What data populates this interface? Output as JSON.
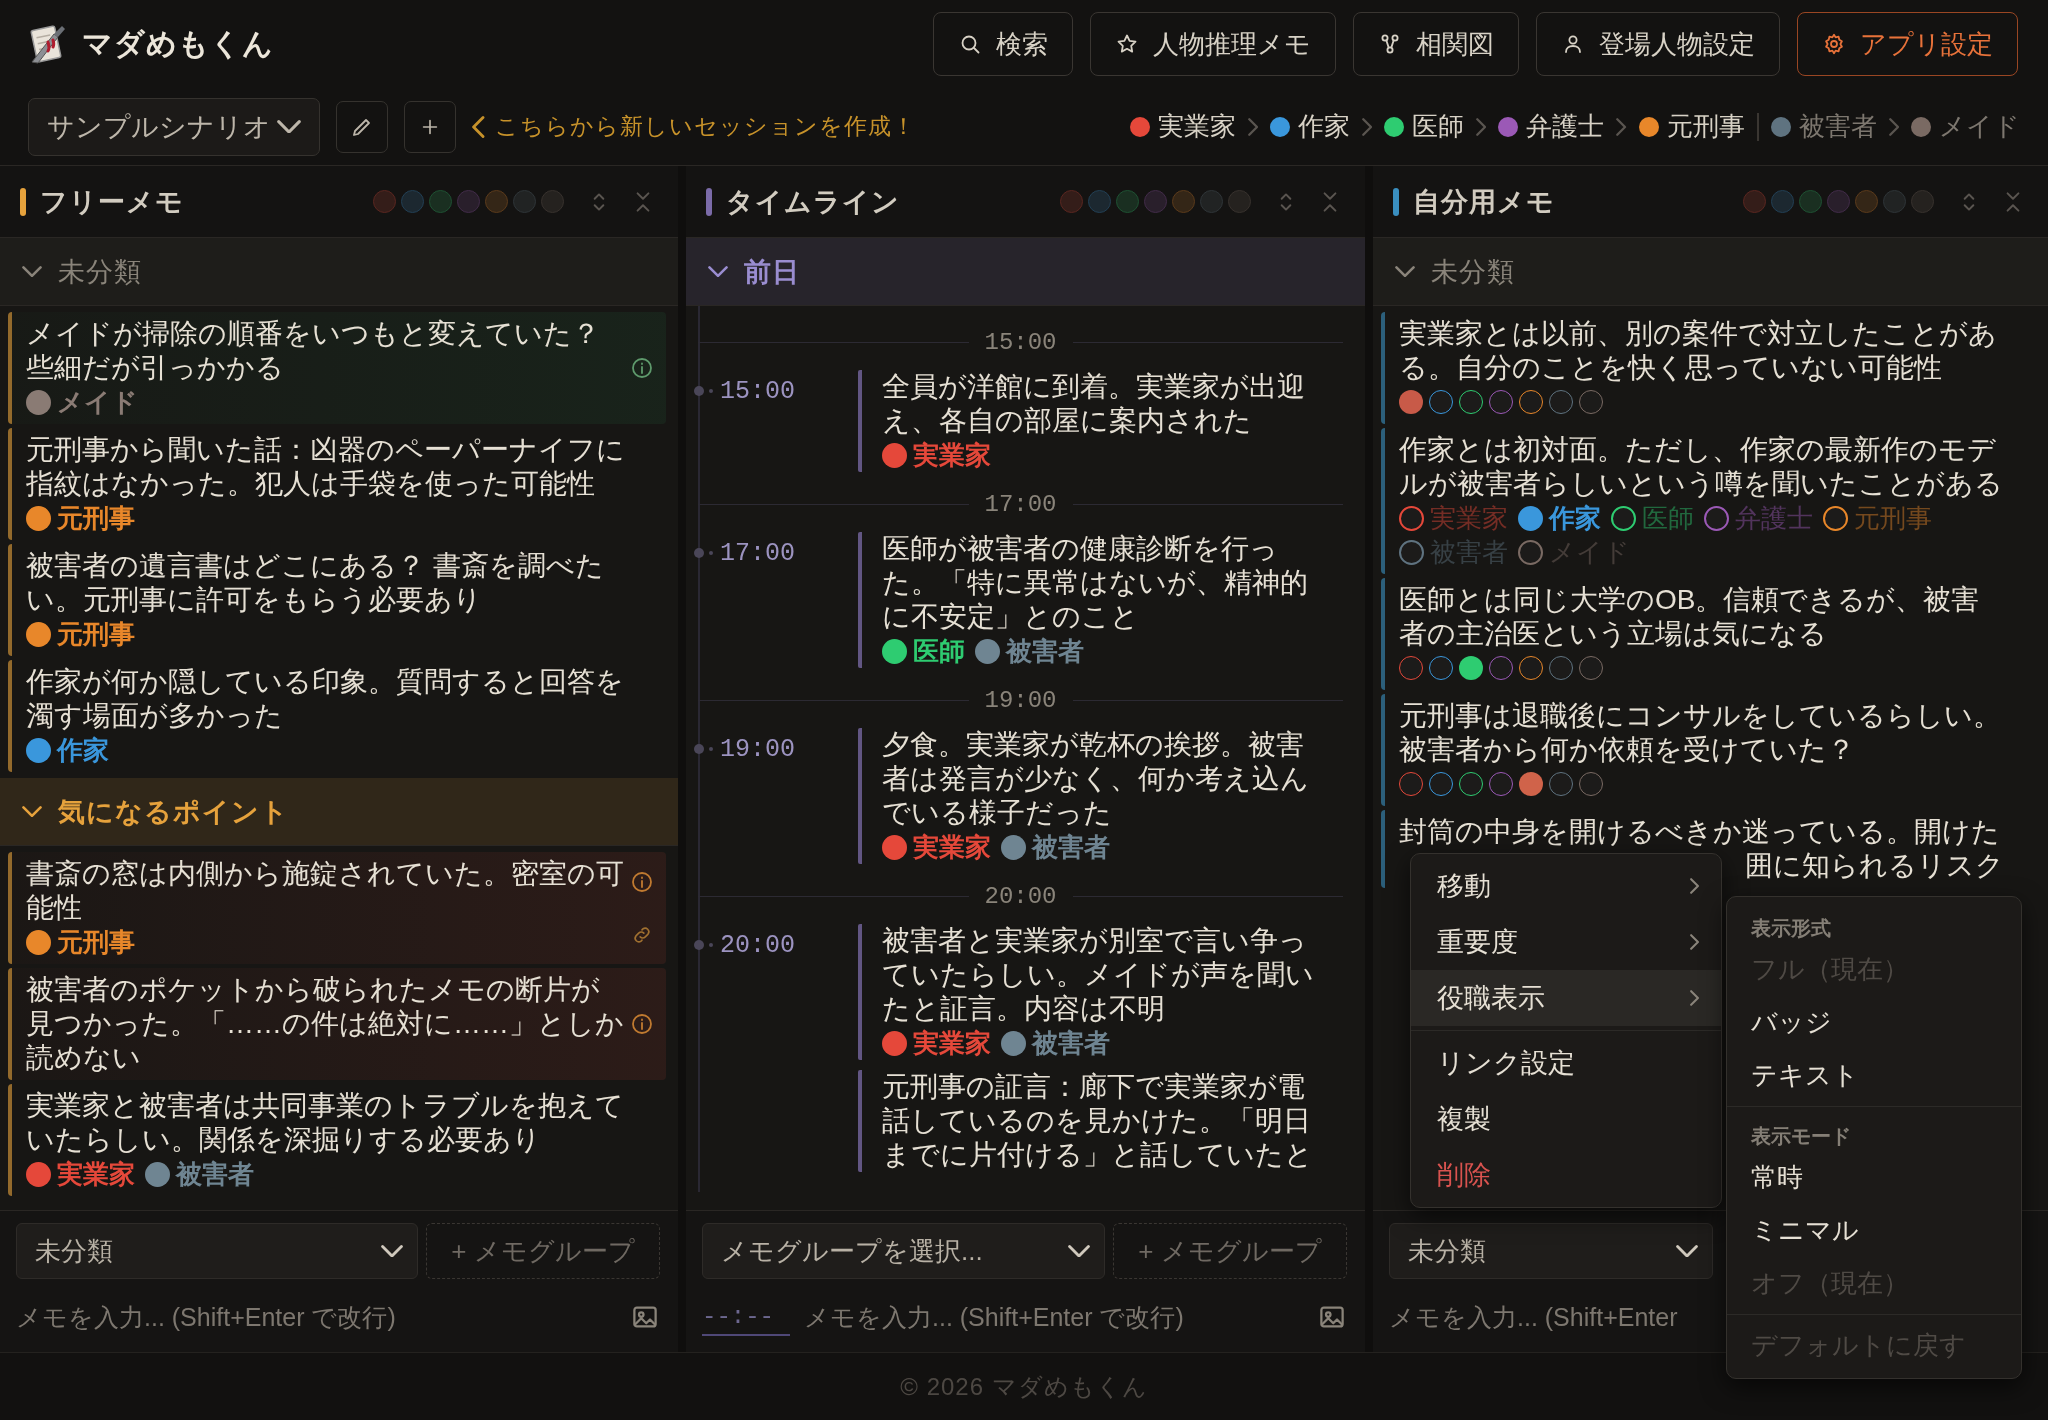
{
  "app": {
    "title": "マダめもくん"
  },
  "nav_buttons": [
    {
      "label": "検索",
      "kind": "normal"
    },
    {
      "label": "人物推理メモ",
      "kind": "normal"
    },
    {
      "label": "相関図",
      "kind": "normal"
    },
    {
      "label": "登場人物設定",
      "kind": "normal"
    },
    {
      "label": "アプリ設定",
      "kind": "accent"
    }
  ],
  "scenario": {
    "value": "サンプルシナリオ"
  },
  "hint": "こちらから新しいセッションを作成！",
  "characters": [
    {
      "name": "実業家",
      "color": "#e5483a",
      "kind": "suspect"
    },
    {
      "name": "作家",
      "color": "#3a97dc",
      "kind": "suspect"
    },
    {
      "name": "医師",
      "color": "#2ecc71",
      "kind": "suspect"
    },
    {
      "name": "弁護士",
      "color": "#9b59b6",
      "kind": "suspect"
    },
    {
      "name": "元刑事",
      "color": "#e8872a",
      "kind": "suspect"
    },
    {
      "name": "被害者",
      "color": "#5f7380",
      "kind": "other"
    },
    {
      "name": "メイド",
      "color": "#7a6a63",
      "kind": "other"
    }
  ],
  "columns": [
    {
      "title": "フリーメモ",
      "color": "#e6a23c",
      "kind": "memo",
      "filters": [
        {
          "on": false
        },
        {
          "on": false
        },
        {
          "on": false
        },
        {
          "on": false
        },
        {
          "on": false
        },
        {
          "on": false
        },
        {
          "on": false
        }
      ],
      "groups": [
        {
          "title": "未分類",
          "color": "#8a847a",
          "expanded": true,
          "memos": [
            {
              "text": "メイドが掃除の順番をいつもと変えていた？些細だが引っかかる",
              "kind": "info",
              "linked": false,
              "tags": [
                {
                  "name": "メイド",
                  "color": "#8a7b74"
                }
              ]
            },
            {
              "text": "元刑事から聞いた話：凶器のペーパーナイフに指紋はなかった。犯人は手袋を使った可能性",
              "kind": "plain",
              "linked": false,
              "tags": [
                {
                  "name": "元刑事",
                  "color": "#e8872a"
                }
              ]
            },
            {
              "text": "被害者の遺言書はどこにある？ 書斎を調べたい。元刑事に許可をもらう必要あり",
              "kind": "plain",
              "linked": false,
              "tags": [
                {
                  "name": "元刑事",
                  "color": "#e8872a"
                }
              ]
            },
            {
              "text": "作家が何か隠している印象。質問すると回答を濁す場面が多かった",
              "kind": "plain",
              "linked": false,
              "tags": [
                {
                  "name": "作家",
                  "color": "#3a97dc"
                }
              ]
            }
          ]
        },
        {
          "title": "気になるポイント",
          "color": "#e6a23c",
          "expanded": true,
          "memos": [
            {
              "text": "書斎の窓は内側から施錠されていた。密室の可能性",
              "kind": "warning",
              "linked": true,
              "tags": [
                {
                  "name": "元刑事",
                  "color": "#e8872a"
                }
              ]
            },
            {
              "text": "被害者のポケットから破られたメモの断片が見つかった。「……の件は絶対に……」としか読めない",
              "kind": "warning",
              "linked": false
            },
            {
              "text": "実業家と被害者は共同事業のトラブルを抱えていたらしい。関係を深掘りする必要あり",
              "kind": "plain",
              "linked": false,
              "tags": [
                {
                  "name": "実業家",
                  "color": "#e5483a"
                },
                {
                  "name": "被害者",
                  "color": "#6f8592"
                }
              ]
            }
          ]
        }
      ],
      "input": {
        "group_select": "未分類",
        "add_group": "+ メモグループ",
        "placeholder": "メモを入力... (Shift+Enter で改行)"
      }
    },
    {
      "title": "タイムライン",
      "color": "#7b6ba8",
      "kind": "timeline",
      "filters": [
        {
          "on": false
        },
        {
          "on": false
        },
        {
          "on": false
        },
        {
          "on": false
        },
        {
          "on": false
        },
        {
          "on": false
        },
        {
          "on": false
        }
      ],
      "groups": [
        {
          "title": "前日",
          "color": "#9a8dd0",
          "expanded": true,
          "entries": [
            {
              "divider": "15:00",
              "time": "15:00",
              "text": "全員が洋館に到着。実業家が出迎え、各自の部屋に案内された",
              "tags": [
                {
                  "name": "実業家",
                  "color": "#e5483a"
                }
              ]
            },
            {
              "divider": "17:00",
              "time": "17:00",
              "text": "医師が被害者の健康診断を行った。「特に異常はないが、精神的に不安定」とのこと",
              "tags": [
                {
                  "name": "医師",
                  "color": "#2ecc71"
                },
                {
                  "name": "被害者",
                  "color": "#6f8592"
                }
              ]
            },
            {
              "divider": "19:00",
              "time": "19:00",
              "text": "夕食。実業家が乾杯の挨拶。被害者は発言が少なく、何か考え込んでいる様子だった",
              "tags": [
                {
                  "name": "実業家",
                  "color": "#e5483a"
                },
                {
                  "name": "被害者",
                  "color": "#6f8592"
                }
              ]
            },
            {
              "divider": "20:00",
              "time": "20:00",
              "text": "被害者と実業家が別室で言い争っていたらしい。メイドが声を聞いたと証言。内容は不明",
              "tags": [
                {
                  "name": "実業家",
                  "color": "#e5483a"
                },
                {
                  "name": "被害者",
                  "color": "#6f8592"
                }
              ]
            },
            {
              "text": "元刑事の証言：廊下で実業家が電話しているのを見かけた。「明日までに片付ける」と話していたと"
            }
          ]
        }
      ],
      "input": {
        "group_select": "メモグループを選択...",
        "add_group": "+ メモグループ",
        "time_placeholder": "--:--",
        "placeholder": "メモを入力... (Shift+Enter で改行)"
      }
    },
    {
      "title": "自分用メモ",
      "color": "#3a8fc0",
      "kind": "memo",
      "filters": [
        {
          "on": false
        },
        {
          "on": false
        },
        {
          "on": false
        },
        {
          "on": false
        },
        {
          "on": false
        },
        {
          "on": false
        },
        {
          "on": false
        }
      ],
      "groups": [
        {
          "title": "未分類",
          "color": "#8a847a",
          "expanded": true,
          "memos": [
            {
              "text": "実業家とは以前、別の案件で対立したことがある。自分のことを快く思っていない可能性",
              "kind": "plain",
              "linked": false,
              "tags": [
                {
                  "color": "#c85a48",
                  "selected": true
                },
                {
                  "color": "#3a97dc",
                  "selected": false
                },
                {
                  "color": "#2ecc71",
                  "selected": false
                },
                {
                  "color": "#9b59b6",
                  "selected": false
                },
                {
                  "color": "#e8872a",
                  "selected": false
                },
                {
                  "color": "#5f7380",
                  "selected": false
                },
                {
                  "color": "#7a6a63",
                  "selected": false
                }
              ]
            },
            {
              "text": "作家とは初対面。ただし、作家の最新作のモデルが被害者らしいという噂を聞いたことがある",
              "kind": "plain",
              "linked": false,
              "tags": [
                {
                  "name": "実業家",
                  "color": "#e5483a",
                  "selected": false
                },
                {
                  "name": "作家",
                  "color": "#3a97dc",
                  "selected": true
                },
                {
                  "name": "医師",
                  "color": "#2ecc71",
                  "selected": false
                },
                {
                  "name": "弁護士",
                  "color": "#9b59b6",
                  "selected": false
                },
                {
                  "name": "元刑事",
                  "color": "#e8872a",
                  "selected": false
                },
                {
                  "name": "被害者",
                  "color": "#5f7380",
                  "selected": false
                },
                {
                  "name": "メイド",
                  "color": "#7a6a63",
                  "selected": false
                }
              ]
            },
            {
              "text": "医師とは同じ大学のOB。信頼できるが、被害者の主治医という立場は気になる",
              "kind": "plain",
              "linked": false,
              "tags": [
                {
                  "color": "#e5483a",
                  "selected": false
                },
                {
                  "color": "#3a97dc",
                  "selected": false
                },
                {
                  "color": "#2ecc71",
                  "selected": true
                },
                {
                  "color": "#9b59b6",
                  "selected": false
                },
                {
                  "color": "#e8872a",
                  "selected": false
                },
                {
                  "color": "#5f7380",
                  "selected": false
                },
                {
                  "color": "#7a6a63",
                  "selected": false
                }
              ]
            },
            {
              "text": "元刑事は退職後にコンサルをしているらしい。被害者から何か依頼を受けていた？",
              "kind": "plain",
              "linked": false,
              "tags": [
                {
                  "color": "#e5483a",
                  "selected": false
                },
                {
                  "color": "#3a97dc",
                  "selected": false
                },
                {
                  "color": "#2ecc71",
                  "selected": false
                },
                {
                  "color": "#9b59b6",
                  "selected": false
                },
                {
                  "color": "#d0634a",
                  "selected": true
                },
                {
                  "color": "#5f7380",
                  "selected": false
                },
                {
                  "color": "#7a6a63",
                  "selected": false
                }
              ]
            },
            {
              "text": "封筒の中身を開けるべきか迷っている。開けた",
              "continued": "囲に知られるリスク",
              "kind": "plain",
              "linked": false
            }
          ]
        }
      ],
      "input": {
        "group_select": "未分類",
        "placeholder": "メモを入力... (Shift+Enter"
      }
    }
  ],
  "context_menu": {
    "items": [
      {
        "label": "移動",
        "kind": "submenu",
        "selected": false
      },
      {
        "label": "重要度",
        "kind": "submenu",
        "selected": false
      },
      {
        "label": "役職表示",
        "kind": "submenu",
        "selected": true
      },
      {
        "kind": "divider"
      },
      {
        "label": "リンク設定",
        "kind": "action",
        "selected": false
      },
      {
        "label": "複製",
        "kind": "action",
        "selected": false
      },
      {
        "label": "削除",
        "kind": "danger",
        "selected": false
      }
    ],
    "submenu": [
      {
        "kind": "header",
        "label": "表示形式"
      },
      {
        "kind": "item",
        "label": "フル（現在）",
        "disabled": true
      },
      {
        "kind": "item",
        "label": "バッジ",
        "disabled": false
      },
      {
        "kind": "item",
        "label": "テキスト",
        "disabled": false
      },
      {
        "kind": "divider"
      },
      {
        "kind": "header",
        "label": "表示モード"
      },
      {
        "kind": "item",
        "label": "常時",
        "disabled": false
      },
      {
        "kind": "item",
        "label": "ミニマル",
        "disabled": false
      },
      {
        "kind": "item",
        "label": "オフ（現在）",
        "disabled": true
      },
      {
        "kind": "divider"
      },
      {
        "kind": "item",
        "label": "デフォルトに戻す",
        "disabled": true
      }
    ]
  },
  "footer": "© 2026 マダめもくん"
}
